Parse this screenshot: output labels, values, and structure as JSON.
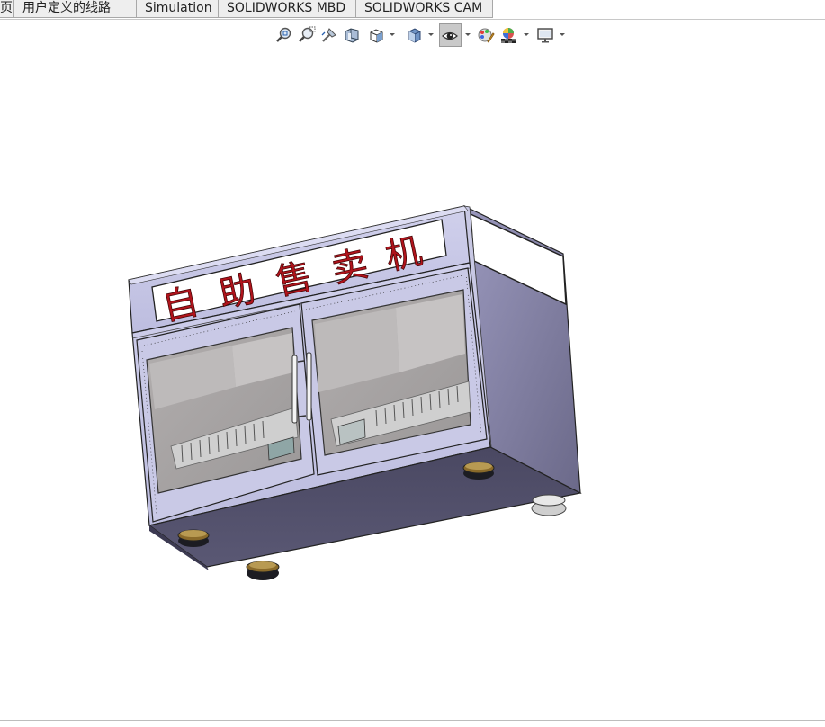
{
  "tabs": [
    {
      "label": "页"
    },
    {
      "label": "用户定义的线路"
    },
    {
      "label": "Simulation"
    },
    {
      "label": "SOLIDWORKS MBD"
    },
    {
      "label": "SOLIDWORKS CAM"
    }
  ],
  "model": {
    "sign_text": [
      "自",
      "助",
      "售",
      "卖",
      "机"
    ]
  },
  "view_toolbar": {
    "icons": [
      "zoom-to-fit-icon",
      "zoom-to-area-icon",
      "previous-view-icon",
      "section-view-icon",
      "view-orientation-icon",
      "display-style-icon",
      "hide-show-items-icon",
      "edit-appearance-icon",
      "apply-scene-icon",
      "view-settings-icon"
    ]
  },
  "colors": {
    "tab_bg": "#eeeeee",
    "sign_text": "#b0141c",
    "cabinet_frame": "#c5c5e6",
    "cabinet_dark": "#504e66"
  }
}
